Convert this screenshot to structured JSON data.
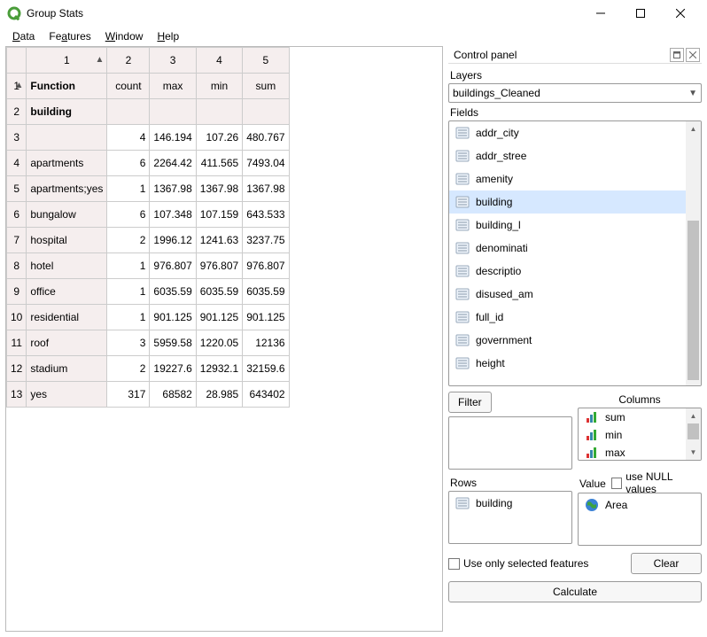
{
  "window": {
    "title": "Group Stats"
  },
  "menu": {
    "data": "Data",
    "features": "Features",
    "window": "Window",
    "help": "Help"
  },
  "table": {
    "top_cols": [
      "1",
      "2",
      "3",
      "4",
      "5"
    ],
    "header_label": "Function",
    "stat_cols": [
      "count",
      "max",
      "min",
      "sum"
    ],
    "rows": [
      {
        "n": "1"
      },
      {
        "n": "2",
        "cat": "building",
        "bold": true
      },
      {
        "n": "3",
        "cat": "",
        "v": [
          "4",
          "146.194",
          "107.26",
          "480.767"
        ]
      },
      {
        "n": "4",
        "cat": "apartments",
        "v": [
          "6",
          "2264.42",
          "411.565",
          "7493.04"
        ]
      },
      {
        "n": "5",
        "cat": "apartments;yes",
        "v": [
          "1",
          "1367.98",
          "1367.98",
          "1367.98"
        ]
      },
      {
        "n": "6",
        "cat": "bungalow",
        "v": [
          "6",
          "107.348",
          "107.159",
          "643.533"
        ]
      },
      {
        "n": "7",
        "cat": "hospital",
        "v": [
          "2",
          "1996.12",
          "1241.63",
          "3237.75"
        ]
      },
      {
        "n": "8",
        "cat": "hotel",
        "v": [
          "1",
          "976.807",
          "976.807",
          "976.807"
        ]
      },
      {
        "n": "9",
        "cat": "office",
        "v": [
          "1",
          "6035.59",
          "6035.59",
          "6035.59"
        ]
      },
      {
        "n": "10",
        "cat": "residential",
        "v": [
          "1",
          "901.125",
          "901.125",
          "901.125"
        ]
      },
      {
        "n": "11",
        "cat": "roof",
        "v": [
          "3",
          "5959.58",
          "1220.05",
          "12136"
        ]
      },
      {
        "n": "12",
        "cat": "stadium",
        "v": [
          "2",
          "19227.6",
          "12932.1",
          "32159.6"
        ]
      },
      {
        "n": "13",
        "cat": "yes",
        "v": [
          "317",
          "68582",
          "28.985",
          "643402"
        ]
      }
    ]
  },
  "panel": {
    "title": "Control panel",
    "layers_label": "Layers",
    "layer_selected": "buildings_Cleaned",
    "fields_label": "Fields",
    "fields": [
      "addr_city",
      "addr_stree",
      "amenity",
      "building",
      "building_l",
      "denominati",
      "descriptio",
      "disused_am",
      "full_id",
      "government",
      "height"
    ],
    "fields_selected_index": 3,
    "filter_btn": "Filter",
    "columns_label": "Columns",
    "columns": [
      "sum",
      "min",
      "max"
    ],
    "rows_label": "Rows",
    "rows_item": "building",
    "value_label": "Value",
    "use_null_label": "use NULL values",
    "value_item": "Area",
    "use_only_selected": "Use only selected features",
    "clear_btn": "Clear",
    "calculate_btn": "Calculate"
  }
}
